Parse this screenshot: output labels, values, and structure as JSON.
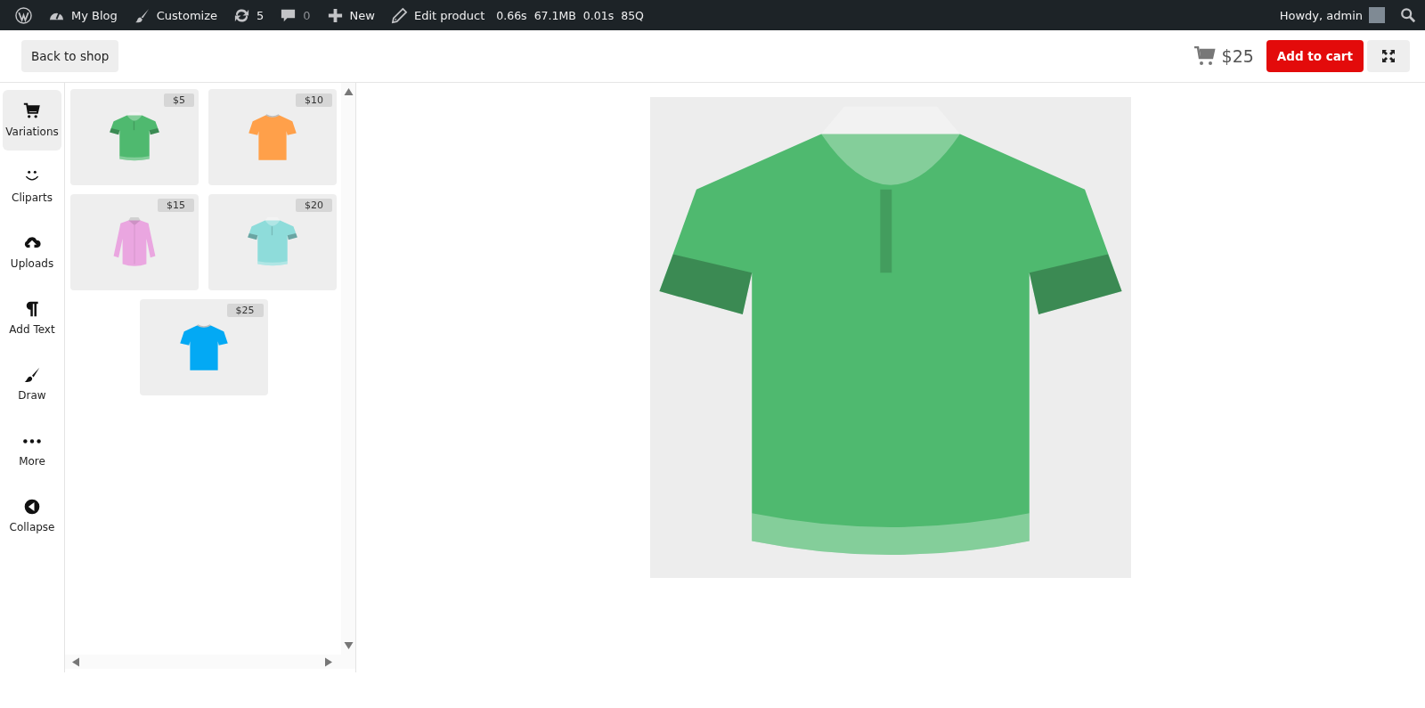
{
  "admin_bar": {
    "items": [
      {
        "kind": "logo"
      },
      {
        "kind": "dashboard",
        "label": "My Blog"
      },
      {
        "kind": "brush",
        "label": "Customize"
      },
      {
        "kind": "updates",
        "label": "5"
      },
      {
        "kind": "comments",
        "label": "0",
        "disabled": true
      },
      {
        "kind": "plus",
        "label": "New"
      },
      {
        "kind": "pencil",
        "label": "Edit product"
      },
      {
        "kind": "stat",
        "label": "0.66s"
      },
      {
        "kind": "stat",
        "label": "67.1MB"
      },
      {
        "kind": "stat",
        "label": "0.01s"
      },
      {
        "kind": "stat",
        "label": "85Q"
      }
    ],
    "greeting": "Howdy, admin"
  },
  "header": {
    "back_button": "Back to shop",
    "price": "$25",
    "add_to_cart": "Add to cart"
  },
  "tools": [
    {
      "kind": "cart",
      "label": "Variations",
      "selected": true
    },
    {
      "kind": "smile",
      "label": "Cliparts",
      "selected": false
    },
    {
      "kind": "cloud",
      "label": "Uploads",
      "selected": false
    },
    {
      "kind": "pilcrow",
      "label": "Add Text",
      "selected": false
    },
    {
      "kind": "brush",
      "label": "Draw",
      "selected": false
    },
    {
      "kind": "dots",
      "label": "More",
      "selected": false
    },
    {
      "kind": "collapse",
      "label": "Collapse",
      "selected": false
    }
  ],
  "variations": [
    {
      "kind": "polo",
      "price": "$5",
      "color": "#4fb96f"
    },
    {
      "kind": "tee",
      "price": "$10",
      "color": "#ffa04a"
    },
    {
      "kind": "shirt",
      "price": "$15",
      "color": "#eaa6e0"
    },
    {
      "kind": "polo",
      "price": "$20",
      "color": "#8edcda"
    },
    {
      "kind": "tee",
      "price": "$25",
      "color": "#03a9f4"
    }
  ],
  "canvas": {
    "kind": "polo",
    "color": "#4fb96f"
  }
}
